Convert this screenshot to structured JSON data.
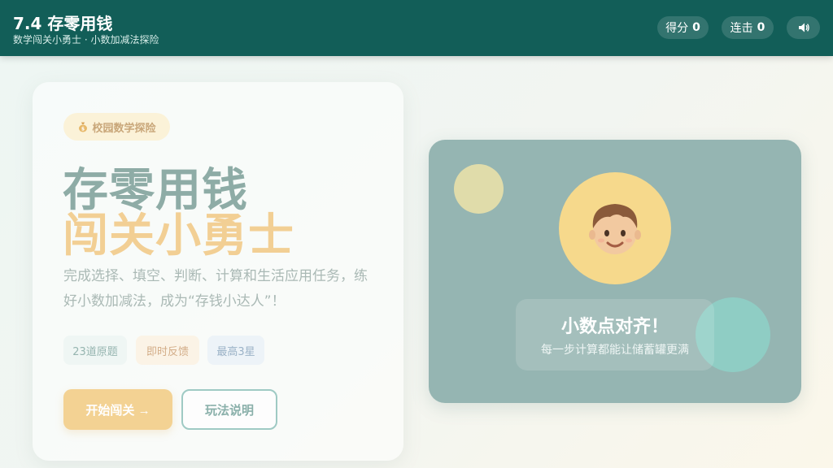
{
  "header": {
    "title": "7.4 存零用钱",
    "subtitle": "数学闯关小勇士 · 小数加减法探险",
    "score_label": "得分",
    "score_value": "0",
    "combo_label": "连击",
    "combo_value": "0",
    "sound_icon": "speaker-icon"
  },
  "intro": {
    "badge_icon": "money-bag-icon",
    "badge_text": "校园数学探险",
    "title_line1": "存零用钱",
    "title_line2": "闯关小勇士",
    "description": "完成选择、填空、判断、计算和生活应用任务，练好小数加减法，成为“存钱小达人”！",
    "tags": [
      "23道原题",
      "即时反馈",
      "最高3星"
    ],
    "start_button": "开始闯关 →",
    "help_button": "玩法说明"
  },
  "mascot": {
    "avatar_icon": "boy-face-icon",
    "message_title": "小数点对齐！",
    "message_subtitle": "每一步计算都能让储蓄罐更满"
  },
  "colors": {
    "header_bg": "#125e58",
    "accent_yellow": "#f3d293",
    "accent_teal": "#8fcdc4",
    "panel_bg": "#95b5b2"
  }
}
